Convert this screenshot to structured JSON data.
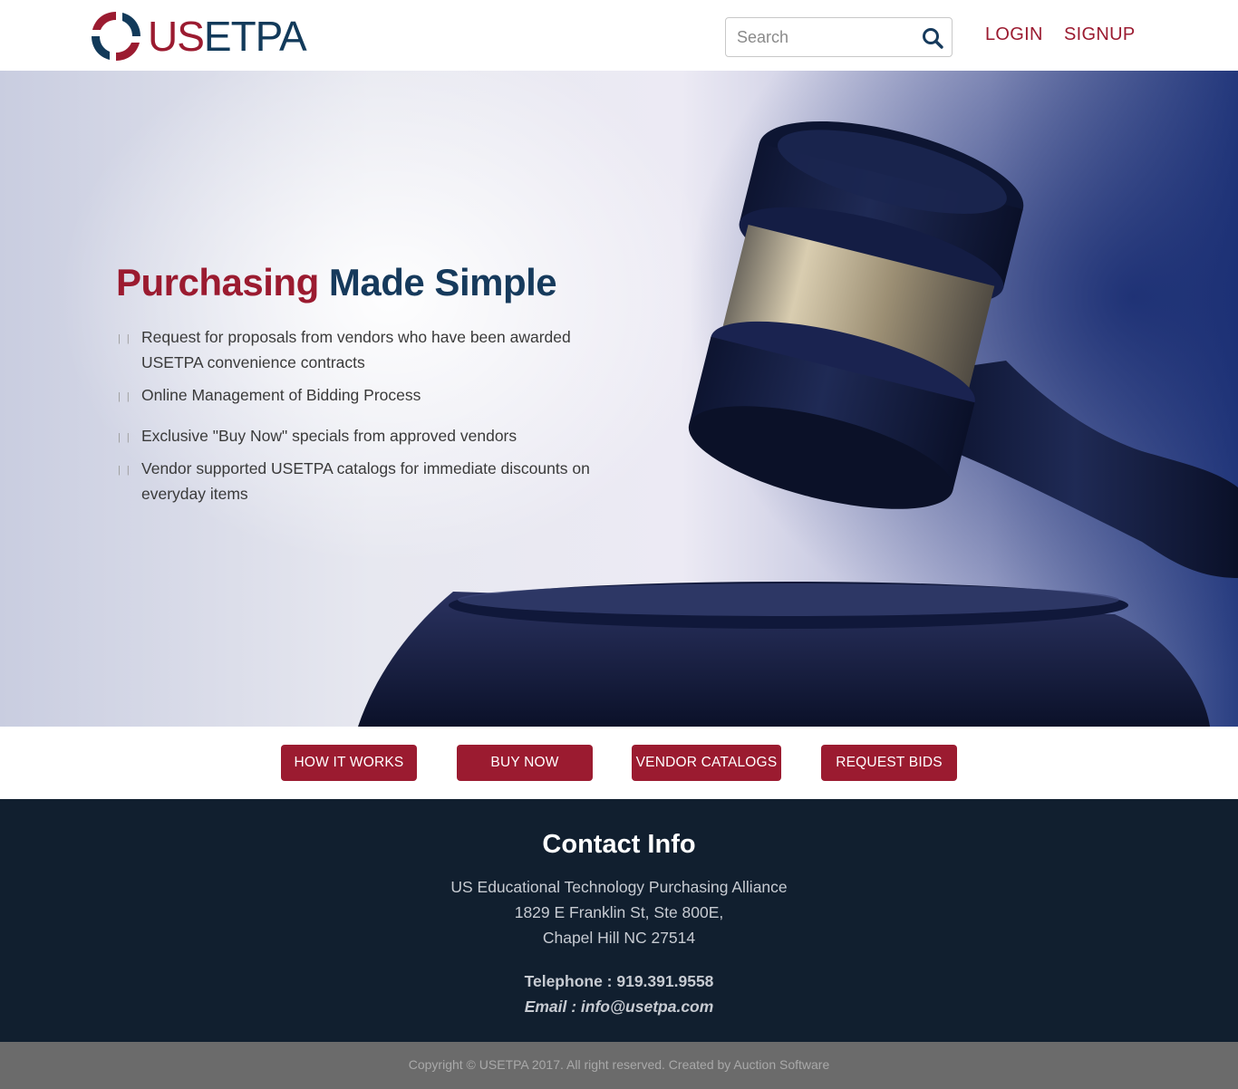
{
  "brand": {
    "logo_text_us": "US",
    "logo_text_rest": "ETPA",
    "colors": {
      "primary": "#9b1b30",
      "navy": "#123a5a",
      "footer_bg": "#111f2f",
      "copyright_bg": "#6b6b6b"
    }
  },
  "header": {
    "search": {
      "placeholder": "Search",
      "value": "",
      "icon": "search-icon"
    },
    "login_label": "LOGIN",
    "signup_label": "SIGNUP"
  },
  "hero": {
    "title_part1": "Purchasing",
    "title_part2": "Made Simple",
    "bullets": [
      "Request for proposals from vendors who have been awarded USETPA convenience contracts",
      "Online Management of Bidding Process",
      "Exclusive \"Buy Now\" specials from approved vendors",
      "Vendor supported USETPA catalogs for immediate discounts on everyday items"
    ],
    "image": "gavel-image"
  },
  "actions": {
    "how_it_works": "HOW IT WORKS",
    "buy_now": "BUY NOW",
    "vendor_catalogs": "VENDOR CATALOGS",
    "request_bids": "REQUEST BIDS"
  },
  "contact": {
    "heading": "Contact Info",
    "org": "US Educational Technology Purchasing Alliance",
    "street": "1829 E Franklin St, Ste 800E,",
    "city": "Chapel Hill NC 27514",
    "telephone": "Telephone : 919.391.9558",
    "email": "Email : info@usetpa.com"
  },
  "footer": {
    "copyright": "Copyright © USETPA 2017. All right reserved. Created by Auction Software"
  }
}
